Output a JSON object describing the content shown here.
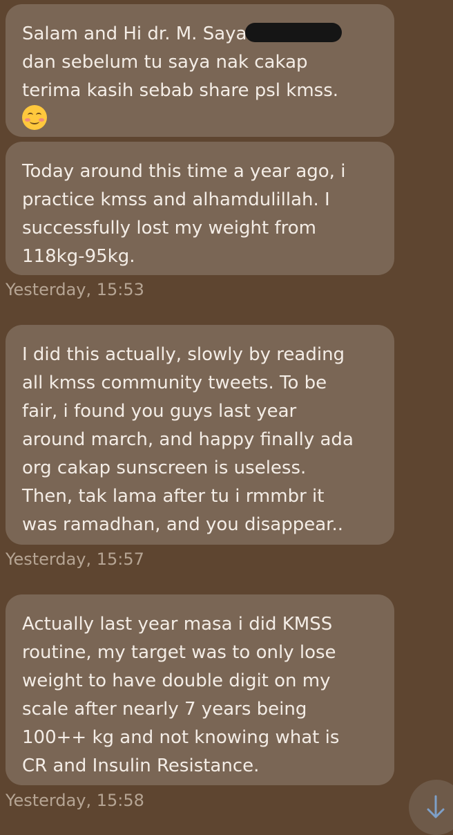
{
  "messages": [
    {
      "lines": [
        "Salam and Hi dr. M. Saya",
        "dan sebelum tu saya nak cakap",
        "terima kasih sebab share psl kmss."
      ],
      "emoji": "smiling-face-with-smiling-eyes-icon"
    },
    {
      "lines": [
        "Today around this time a year ago, i",
        "practice kmss and alhamdulillah. I",
        "successfully lost my weight from",
        "118kg-95kg."
      ],
      "time": "Yesterday, 15:53"
    },
    {
      "lines": [
        "I did this actually, slowly by reading",
        "all kmss community tweets. To be",
        "fair, i found you guys last year",
        "around march, and happy finally ada",
        "org cakap sunscreen is useless.",
        "Then, tak lama after tu i rmmbr it",
        "was ramadhan, and you disappear.."
      ],
      "time": "Yesterday, 15:57"
    },
    {
      "lines": [
        "Actually last year masa i did KMSS",
        "routine, my target was to only lose",
        "weight to have double digit on my",
        "scale after nearly 7 years being",
        "100++ kg and not knowing what is",
        "CR and Insulin Resistance."
      ],
      "time": "Yesterday, 15:58"
    }
  ],
  "scroll_down_icon": "arrow-down-icon",
  "colors": {
    "background": "#5e4530",
    "bubble": "#7a6655",
    "text": "#f4ede6",
    "timestamp": "#b6a594",
    "accent": "#7ea0c8"
  }
}
